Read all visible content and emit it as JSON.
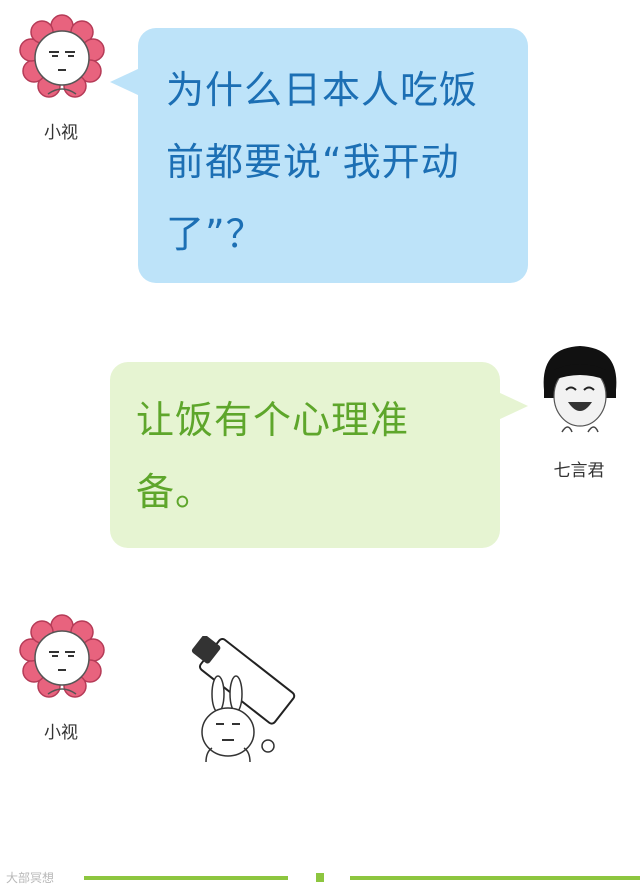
{
  "messages": [
    {
      "sender": "小视",
      "text": "为什么日本人吃饭前都要说“我开动了”？"
    },
    {
      "sender": "七言君",
      "text": "让饭有个心理准备。"
    },
    {
      "sender": "小视",
      "content": "sticker",
      "sticker_icon": "bunny-with-cleaver-sticker"
    }
  ],
  "footer": {
    "watermark": "大部冥想"
  },
  "colors": {
    "left_bubble_bg": "#bde3f9",
    "left_bubble_text": "#1c6fb4",
    "right_bubble_bg": "#e6f4d2",
    "right_bubble_text": "#5ea62b",
    "footer_accent": "#8dc63f"
  },
  "icons": {
    "avatar_xiaoshi": "flower-face-avatar-icon",
    "avatar_qiyanjun": "laughing-face-avatar-icon"
  }
}
